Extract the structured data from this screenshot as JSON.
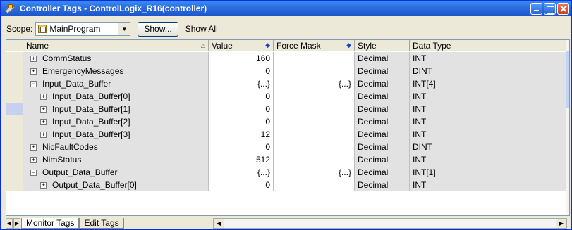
{
  "window": {
    "title": "Controller Tags - ControlLogix_R16(controller)"
  },
  "toolbar": {
    "scope_label": "Scope:",
    "scope_value": "MainProgram",
    "show_button": "Show...",
    "show_filter": "Show All"
  },
  "columns": {
    "name": "Name",
    "value": "Value",
    "force_mask": "Force Mask",
    "style": "Style",
    "data_type": "Data Type"
  },
  "rows": [
    {
      "name": "CommStatus",
      "value": "160",
      "force": "",
      "style": "Decimal",
      "dtype": "INT",
      "expander": "+",
      "child": false
    },
    {
      "name": "EmergencyMessages",
      "value": "0",
      "force": "",
      "style": "Decimal",
      "dtype": "DINT",
      "expander": "+",
      "child": false
    },
    {
      "name": "Input_Data_Buffer",
      "value": "{...}",
      "force": "{...}",
      "style": "Decimal",
      "dtype": "INT[4]",
      "expander": "−",
      "child": false
    },
    {
      "name": "Input_Data_Buffer[0]",
      "value": "0",
      "force": "",
      "style": "Decimal",
      "dtype": "INT",
      "expander": "+",
      "child": true
    },
    {
      "name": "Input_Data_Buffer[1]",
      "value": "0",
      "force": "",
      "style": "Decimal",
      "dtype": "INT",
      "expander": "+",
      "child": true
    },
    {
      "name": "Input_Data_Buffer[2]",
      "value": "0",
      "force": "",
      "style": "Decimal",
      "dtype": "INT",
      "expander": "+",
      "child": true
    },
    {
      "name": "Input_Data_Buffer[3]",
      "value": "12",
      "force": "",
      "style": "Decimal",
      "dtype": "INT",
      "expander": "+",
      "child": true
    },
    {
      "name": "NicFaultCodes",
      "value": "0",
      "force": "",
      "style": "Decimal",
      "dtype": "DINT",
      "expander": "+",
      "child": false
    },
    {
      "name": "NimStatus",
      "value": "512",
      "force": "",
      "style": "Decimal",
      "dtype": "INT",
      "expander": "+",
      "child": false
    },
    {
      "name": "Output_Data_Buffer",
      "value": "{...}",
      "force": "{...}",
      "style": "Decimal",
      "dtype": "INT[1]",
      "expander": "−",
      "child": false
    },
    {
      "name": "Output_Data_Buffer[0]",
      "value": "0",
      "force": "",
      "style": "Decimal",
      "dtype": "INT",
      "expander": "+",
      "child": true
    }
  ],
  "tabs": {
    "monitor": "Monitor Tags",
    "edit": "Edit Tags"
  }
}
